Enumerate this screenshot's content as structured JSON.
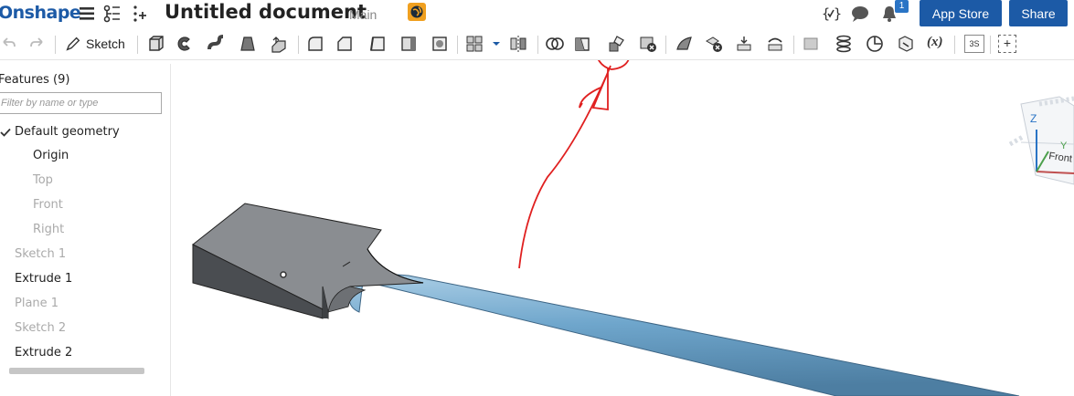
{
  "topbar": {
    "logo": "Onshape",
    "document_title": "Untitled document",
    "branch": "Main",
    "notifications_count": "1",
    "app_store_label": "App Store",
    "share_label": "Share"
  },
  "toolbar": {
    "sketch_label": "Sketch",
    "variable_label": "(x)",
    "three_s_label": "3S",
    "add_label": "+"
  },
  "feature_panel": {
    "title": "Features (9)",
    "filter_placeholder": "Filter by name or type",
    "default_geometry": "Default geometry",
    "items": [
      {
        "label": "Origin",
        "active": true
      },
      {
        "label": "Top",
        "active": false
      },
      {
        "label": "Front",
        "active": false
      },
      {
        "label": "Right",
        "active": false
      },
      {
        "label": "Sketch 1",
        "active": false
      },
      {
        "label": "Extrude 1",
        "active": true
      },
      {
        "label": "Plane 1",
        "active": false
      },
      {
        "label": "Sketch 2",
        "active": false
      },
      {
        "label": "Extrude 2",
        "active": true
      }
    ]
  },
  "view_cube": {
    "axis_z": "Z",
    "axis_y": "Y",
    "face_front": "Front"
  },
  "colors": {
    "brand": "#1c5aa6",
    "part_block": "#8a8d91",
    "part_cylinder": "#6fa6cc",
    "annotation": "#e02020"
  }
}
